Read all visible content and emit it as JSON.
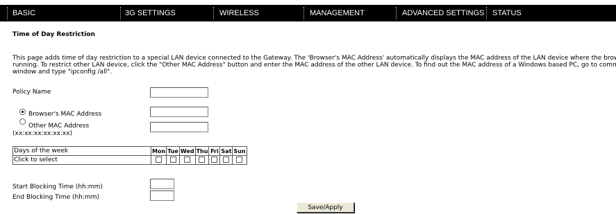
{
  "nav": {
    "items": [
      {
        "label": "BASIC"
      },
      {
        "label": "3G SETTINGS"
      },
      {
        "label": "WIRELESS"
      },
      {
        "label": "MANAGEMENT"
      },
      {
        "label": "ADVANCED SETTINGS"
      },
      {
        "label": "STATUS"
      }
    ]
  },
  "page": {
    "title": "Time of Day Restriction",
    "description": [
      "This page adds time of day restriction to a special LAN device connected to the Gateway. The 'Browser's MAC Address' automatically displays the MAC address of the LAN device where the browser is",
      "running. To restrict other LAN device, click the \"Other MAC Address\" button and enter the MAC address of the other LAN device. To find out the MAC address of a Windows based PC, go to command",
      "window and type \"ipconfig /all\"."
    ]
  },
  "form": {
    "policy_name_label": "Policy Name",
    "policy_name_value": "",
    "browser_mac_label": "Browser's MAC Address",
    "browser_mac_value": "",
    "other_mac_label": "Other MAC Address",
    "other_mac_hint": "(xx:xx:xx:xx:xx:xx)",
    "other_mac_value": "",
    "selected_mac_option": "browser",
    "days_header": "Days of the week",
    "days": [
      "Mon",
      "Tue",
      "Wed",
      "Thu",
      "Fri",
      "Sat",
      "Sun"
    ],
    "click_label": "Click to select",
    "start_label": "Start Blocking Time (hh:mm)",
    "start_value": "",
    "end_label": "End Blocking Time (hh:mm)",
    "end_value": "",
    "save_label": "Save/Apply"
  }
}
